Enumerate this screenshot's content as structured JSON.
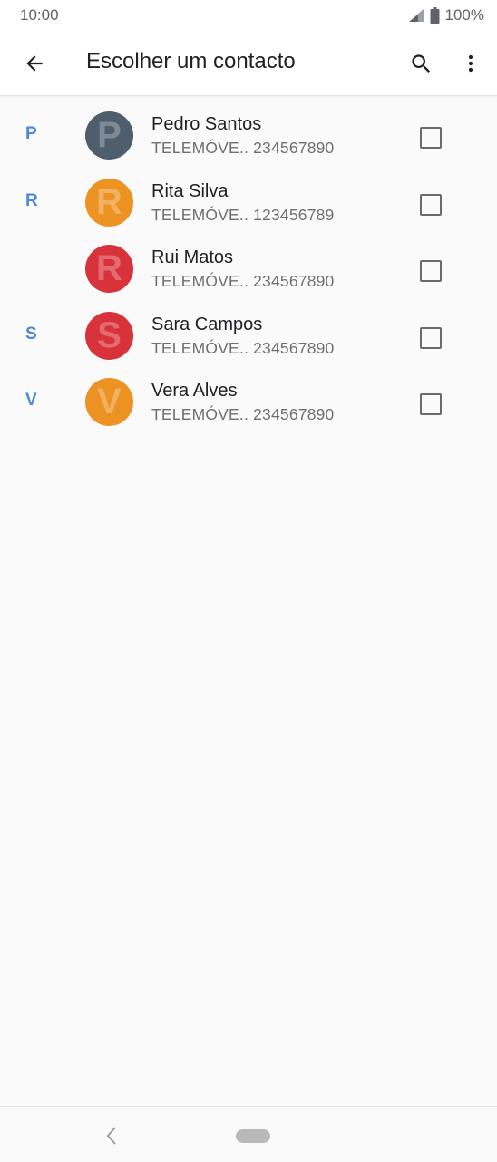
{
  "status_bar": {
    "time": "10:00",
    "battery": "100%"
  },
  "app_bar": {
    "title": "Escolher um contacto"
  },
  "contacts": [
    {
      "letter": "P",
      "name": "Pedro Santos",
      "label": "TELEMÓVE..",
      "number": "234567890",
      "avatar_initial": "P",
      "avatar_color": "#4e5e6c"
    },
    {
      "letter": "R",
      "name": "Rita Silva",
      "label": "TELEMÓVE..",
      "number": "123456789",
      "avatar_initial": "R",
      "avatar_color": "#ec9323"
    },
    {
      "letter": "",
      "name": "Rui Matos",
      "label": "TELEMÓVE..",
      "number": "234567890",
      "avatar_initial": "R",
      "avatar_color": "#d8333a"
    },
    {
      "letter": "S",
      "name": "Sara Campos",
      "label": "TELEMÓVE..",
      "number": "234567890",
      "avatar_initial": "S",
      "avatar_color": "#d8333a"
    },
    {
      "letter": "V",
      "name": "Vera Alves",
      "label": "TELEMÓVE..",
      "number": "234567890",
      "avatar_initial": "V",
      "avatar_color": "#ec9323"
    }
  ],
  "colors": {
    "accent": "#4a89dc",
    "text_primary": "#202124",
    "text_secondary": "#6f6f6f"
  },
  "icons": {
    "back": "arrow-left-icon",
    "search": "search-icon",
    "more": "more-vert-icon",
    "signal": "signal-icon",
    "battery": "battery-icon",
    "nav_back": "chevron-left-icon",
    "nav_home": "home-pill-icon"
  }
}
